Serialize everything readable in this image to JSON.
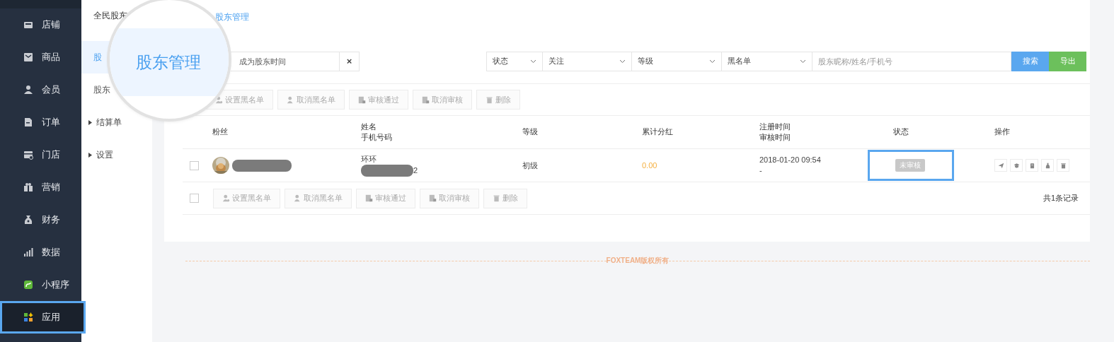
{
  "sidebar": {
    "items": [
      {
        "label": "店铺",
        "selected": false,
        "highlighted": false
      },
      {
        "label": "商品",
        "selected": false,
        "highlighted": false
      },
      {
        "label": "会员",
        "selected": false,
        "highlighted": false
      },
      {
        "label": "订单",
        "selected": false,
        "highlighted": false
      },
      {
        "label": "门店",
        "selected": false,
        "highlighted": false
      },
      {
        "label": "营销",
        "selected": false,
        "highlighted": false
      },
      {
        "label": "财务",
        "selected": false,
        "highlighted": false
      },
      {
        "label": "数据",
        "selected": false,
        "highlighted": false
      },
      {
        "label": "小程序",
        "selected": false,
        "highlighted": false
      },
      {
        "label": "应用",
        "selected": true,
        "highlighted": true
      }
    ]
  },
  "subnav": {
    "title": "全民股东",
    "items": [
      {
        "label": "股",
        "kind": "link",
        "selected": true
      },
      {
        "label": "股东",
        "kind": "link",
        "selected": false
      },
      {
        "label": "结算单",
        "kind": "group",
        "selected": false
      },
      {
        "label": "设置",
        "kind": "group",
        "selected": false
      }
    ]
  },
  "breadcrumb": "股东管理",
  "magnifier": {
    "text": "股东管理"
  },
  "filters": {
    "date_placeholder": "成为股东时间",
    "clear": "×",
    "selects": [
      "状态",
      "关注",
      "等级",
      "黑名单"
    ],
    "search_placeholder": "股东昵称/姓名/手机号",
    "search_button": "搜索",
    "export_button": "导出"
  },
  "toolbar": [
    {
      "label": "设置黑名单",
      "disabled": true
    },
    {
      "label": "取消黑名单",
      "disabled": true
    },
    {
      "label": "审核通过",
      "disabled": true
    },
    {
      "label": "取消审核",
      "disabled": true
    },
    {
      "label": "删除",
      "disabled": true
    }
  ],
  "table": {
    "columns": [
      [
        "粉丝"
      ],
      [
        "姓名",
        "手机号码"
      ],
      [
        "等级"
      ],
      [
        "累计分红"
      ],
      [
        "注册时间",
        "审核时间"
      ],
      [
        "状态"
      ],
      [
        "操作"
      ]
    ],
    "rows": [
      {
        "checked": false,
        "name": "环环",
        "phone_tail": "2",
        "level": "初级",
        "dividend": "0.00",
        "registered": "2018-01-20 09:54",
        "reviewed": "-",
        "status": "未审核",
        "status_highlighted": true
      }
    ]
  },
  "bottom_toolbar": [
    {
      "label": "设置黑名单",
      "disabled": true
    },
    {
      "label": "取消黑名单",
      "disabled": true
    },
    {
      "label": "审核通过",
      "disabled": true
    },
    {
      "label": "取消审核",
      "disabled": true
    },
    {
      "label": "删除",
      "disabled": true
    }
  ],
  "bottom_checked": false,
  "record_count": "共1条记录",
  "footer": "FOXTEAM版权所有"
}
